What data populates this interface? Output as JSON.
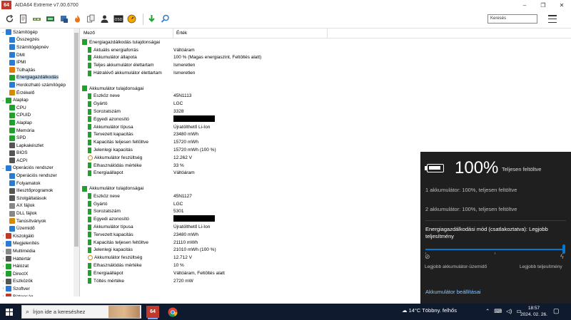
{
  "window": {
    "app_icon_text": "64",
    "title": "AIDA64 Extreme v7.00.6700",
    "controls": [
      "–",
      "❐",
      "✕"
    ]
  },
  "toolbar": {
    "icons": [
      "refresh-icon",
      "report-icon",
      "motherboard-icon",
      "memory-icon",
      "chip-icon",
      "flame-icon",
      "files-icon",
      "user-icon",
      "osd-icon",
      "gauge-icon",
      "download-icon",
      "search-icon"
    ],
    "search_placeholder": "Keresés"
  },
  "tree": {
    "items": [
      {
        "label": "Számítógép",
        "level": 0,
        "expander": "⌄",
        "icon": "computer-icon",
        "color": "#2a7bd4"
      },
      {
        "label": "Összegzés",
        "level": 1,
        "expander": "",
        "icon": "summary-icon",
        "color": "#2a7bd4"
      },
      {
        "label": "Számítógépnév",
        "level": 1,
        "expander": "",
        "icon": "pc-name-icon",
        "color": "#2a7bd4"
      },
      {
        "label": "DMI",
        "level": 1,
        "expander": "",
        "icon": "dmi-icon",
        "color": "#2a7bd4"
      },
      {
        "label": "IPMI",
        "level": 1,
        "expander": "",
        "icon": "ipmi-icon",
        "color": "#2a7bd4"
      },
      {
        "label": "Túlhajtás",
        "level": 1,
        "expander": "",
        "icon": "flame-icon",
        "color": "#e07a00"
      },
      {
        "label": "Energiagazdálkodás",
        "level": 1,
        "expander": "",
        "icon": "battery-icon",
        "color": "#1fa12b",
        "selected": true
      },
      {
        "label": "Hordozható számítógép",
        "level": 1,
        "expander": "",
        "icon": "laptop-icon",
        "color": "#2a7bd4"
      },
      {
        "label": "Érzékelő",
        "level": 1,
        "expander": "",
        "icon": "sensor-icon",
        "color": "#d68a00"
      },
      {
        "label": "Alaplap",
        "level": 0,
        "expander": "⌄",
        "icon": "motherboard-icon",
        "color": "#1fa12b"
      },
      {
        "label": "CPU",
        "level": 1,
        "expander": "",
        "icon": "cpu-icon",
        "color": "#1fa12b"
      },
      {
        "label": "CPUID",
        "level": 1,
        "expander": "",
        "icon": "cpuid-icon",
        "color": "#1fa12b"
      },
      {
        "label": "Alaplap",
        "level": 1,
        "expander": "",
        "icon": "board-icon",
        "color": "#1fa12b"
      },
      {
        "label": "Memória",
        "level": 1,
        "expander": "",
        "icon": "memory-icon",
        "color": "#1fa12b"
      },
      {
        "label": "SPD",
        "level": 1,
        "expander": "",
        "icon": "spd-icon",
        "color": "#1fa12b"
      },
      {
        "label": "Lapkakészlet",
        "level": 1,
        "expander": "",
        "icon": "chipset-icon",
        "color": "#555555"
      },
      {
        "label": "BIOS",
        "level": 1,
        "expander": "",
        "icon": "bios-icon",
        "color": "#555555"
      },
      {
        "label": "ACPI",
        "level": 1,
        "expander": "",
        "icon": "acpi-icon",
        "color": "#555555"
      },
      {
        "label": "Operációs rendszer",
        "level": 0,
        "expander": "⌄",
        "icon": "windows-icon",
        "color": "#2a7bd4"
      },
      {
        "label": "Operációs rendszer",
        "level": 1,
        "expander": "",
        "icon": "windows-icon",
        "color": "#2a7bd4"
      },
      {
        "label": "Folyamatok",
        "level": 1,
        "expander": "",
        "icon": "process-icon",
        "color": "#2a7bd4"
      },
      {
        "label": "Illesztőprogramok",
        "level": 1,
        "expander": "",
        "icon": "driver-icon",
        "color": "#555555"
      },
      {
        "label": "Szolgáltatások",
        "level": 1,
        "expander": "",
        "icon": "services-icon",
        "color": "#555555"
      },
      {
        "label": "AX fájlok",
        "level": 1,
        "expander": "",
        "icon": "file-icon",
        "color": "#888888"
      },
      {
        "label": "DLL fájlok",
        "level": 1,
        "expander": "",
        "icon": "file-icon",
        "color": "#888888"
      },
      {
        "label": "Tanúsítványok",
        "level": 1,
        "expander": "",
        "icon": "certificate-icon",
        "color": "#d68a00"
      },
      {
        "label": "Üzemidő",
        "level": 1,
        "expander": "",
        "icon": "uptime-icon",
        "color": "#2a7bd4"
      },
      {
        "label": "Kiszolgáló",
        "level": 0,
        "expander": "›",
        "icon": "server-icon",
        "color": "#c0392b"
      },
      {
        "label": "Megjelenítés",
        "level": 0,
        "expander": "›",
        "icon": "display-icon",
        "color": "#2a7bd4"
      },
      {
        "label": "Multimédia",
        "level": 0,
        "expander": "›",
        "icon": "multimedia-icon",
        "color": "#888888"
      },
      {
        "label": "Háttértár",
        "level": 0,
        "expander": "›",
        "icon": "storage-icon",
        "color": "#555555"
      },
      {
        "label": "Hálózat",
        "level": 0,
        "expander": "›",
        "icon": "network-icon",
        "color": "#1fa12b"
      },
      {
        "label": "DirectX",
        "level": 0,
        "expander": "›",
        "icon": "directx-icon",
        "color": "#1fa12b"
      },
      {
        "label": "Eszközök",
        "level": 0,
        "expander": "›",
        "icon": "devices-icon",
        "color": "#555555"
      },
      {
        "label": "Szoftver",
        "level": 0,
        "expander": "›",
        "icon": "software-icon",
        "color": "#2a7bd4"
      },
      {
        "label": "Biztonság",
        "level": 0,
        "expander": "›",
        "icon": "security-icon",
        "color": "#c0392b"
      }
    ]
  },
  "grid": {
    "headers": [
      "Mező",
      "Érték"
    ],
    "rows": [
      {
        "field": "Energiagazdálkodás tulajdonságai",
        "value": "",
        "kind": "section",
        "icon": "battery-icon"
      },
      {
        "field": "Aktuális energiaforrás",
        "value": "Váltóáram",
        "kind": "item",
        "icon": "battery-icon"
      },
      {
        "field": "Akkumulátor állapota",
        "value": "100 % (Magas energiaszint, Feltöltés alatt)",
        "kind": "item",
        "icon": "battery-icon"
      },
      {
        "field": "Teljes akkumulátor élettartam",
        "value": "Ismeretlen",
        "kind": "item",
        "icon": "battery-icon"
      },
      {
        "field": "Hátralévő akkumulátor élettartam",
        "value": "Ismeretlen",
        "kind": "item",
        "icon": "battery-icon"
      },
      {
        "field": "",
        "value": "",
        "kind": "blank",
        "icon": ""
      },
      {
        "field": "Akkumulátor tulajdonságai",
        "value": "",
        "kind": "section",
        "icon": "battery-icon"
      },
      {
        "field": "Eszköz neve",
        "value": "45N1113",
        "kind": "item",
        "icon": "battery-icon"
      },
      {
        "field": "Gyártó",
        "value": "LGC",
        "kind": "item",
        "icon": "battery-icon"
      },
      {
        "field": "Sorozatszám",
        "value": "3328",
        "kind": "item",
        "icon": "battery-icon"
      },
      {
        "field": "Egyedi azonosító",
        "value": "",
        "kind": "redacted",
        "icon": "battery-icon"
      },
      {
        "field": "Akkumulátor típusa",
        "value": "Újratölthető Li-Ion",
        "kind": "item",
        "icon": "battery-icon"
      },
      {
        "field": "Tervezett kapacitás",
        "value": "23480 mWh",
        "kind": "item",
        "icon": "battery-icon"
      },
      {
        "field": "Kapacitás teljesen feltöltve",
        "value": "15720 mWh",
        "kind": "item",
        "icon": "battery-icon"
      },
      {
        "field": "Jelenlegi kapacitás",
        "value": "15720 mWh  (100 %)",
        "kind": "item",
        "icon": "battery-icon"
      },
      {
        "field": "Akkumulátor feszültség",
        "value": "12.262 V",
        "kind": "item",
        "icon": "gauge-icon"
      },
      {
        "field": "Elhasználódás mértéke",
        "value": "33 %",
        "kind": "item",
        "icon": "battery-icon"
      },
      {
        "field": "Energiaállapot",
        "value": "Váltóáram",
        "kind": "item",
        "icon": "battery-icon"
      },
      {
        "field": "",
        "value": "",
        "kind": "blank",
        "icon": ""
      },
      {
        "field": "Akkumulátor tulajdonságai",
        "value": "",
        "kind": "section",
        "icon": "battery-icon"
      },
      {
        "field": "Eszköz neve",
        "value": "45N1127",
        "kind": "item",
        "icon": "battery-icon"
      },
      {
        "field": "Gyártó",
        "value": "LGC",
        "kind": "item",
        "icon": "battery-icon"
      },
      {
        "field": "Sorozatszám",
        "value": "5301",
        "kind": "item",
        "icon": "battery-icon"
      },
      {
        "field": "Egyedi azonosító",
        "value": "",
        "kind": "redacted",
        "icon": "battery-icon"
      },
      {
        "field": "Akkumulátor típusa",
        "value": "Újratölthető Li-Ion",
        "kind": "item",
        "icon": "battery-icon"
      },
      {
        "field": "Tervezett kapacitás",
        "value": "23480 mWh",
        "kind": "item",
        "icon": "battery-icon"
      },
      {
        "field": "Kapacitás teljesen feltöltve",
        "value": "21110 mWh",
        "kind": "item",
        "icon": "battery-icon"
      },
      {
        "field": "Jelenlegi kapacitás",
        "value": "21010 mWh  (100 %)",
        "kind": "item",
        "icon": "battery-icon"
      },
      {
        "field": "Akkumulátor feszültség",
        "value": "12.712 V",
        "kind": "item",
        "icon": "gauge-icon"
      },
      {
        "field": "Elhasználódás mértéke",
        "value": "10 %",
        "kind": "item",
        "icon": "battery-icon"
      },
      {
        "field": "Energiaállapot",
        "value": "Váltóáram, Feltöltés alatt",
        "kind": "item",
        "icon": "battery-icon"
      },
      {
        "field": "Töltés mértéke",
        "value": "2720 mW",
        "kind": "item",
        "icon": "battery-icon"
      }
    ]
  },
  "battery_flyout": {
    "percent": "100%",
    "state": "Teljesen feltöltve",
    "battery1": "1 akkumulátor: 100%, teljesen feltöltve",
    "battery2": "2 akkumulátor: 100%, teljesen feltöltve",
    "mode_label": "Energiagazdálkodási mód (csatlakoztatva): Legjobb teljesítmény",
    "slider_value_fraction": 1.0,
    "low_label": "Legjobb akkumulátor-üzemidő",
    "high_label": "Legjobb teljesítmény",
    "settings_link": "Akkumulátor beállításai",
    "accent_color": "#0078d7"
  },
  "taskbar": {
    "search_placeholder": "Írjon ide a kereséshez",
    "aida_label": "64",
    "weather": "14°C  Többny. felhős",
    "tray_icons": [
      "chevron-up-icon",
      "network-icon",
      "volume-icon",
      "keyboard-icon"
    ],
    "time": "18:57",
    "date": "2024. 02. 26."
  }
}
